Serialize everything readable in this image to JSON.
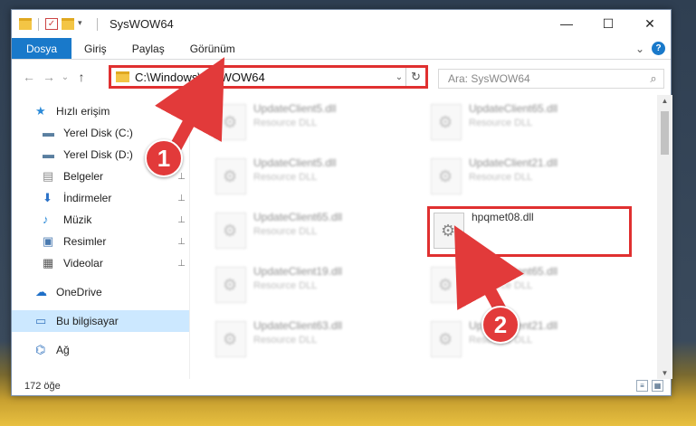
{
  "window": {
    "title": "SysWOW64",
    "controls": {
      "minimize": "—",
      "maximize": "☐",
      "close": "✕"
    }
  },
  "ribbon": {
    "tabs": [
      "Dosya",
      "Giriş",
      "Paylaş",
      "Görünüm"
    ],
    "expand_glyph": "⌄",
    "help_glyph": "?"
  },
  "address": {
    "path": "C:\\Windows\\SysWOW64",
    "back": "←",
    "forward": "→",
    "recent": "⌄",
    "up": "↑",
    "dropdown": "⌄",
    "refresh": "↻"
  },
  "search": {
    "placeholder": "Ara: SysWOW64",
    "icon": "⌕"
  },
  "sidebar": {
    "items": [
      {
        "label": "Hızlı erişim",
        "icon": "star-icon",
        "color": "#2b8ad8",
        "pinned": false
      },
      {
        "label": "Yerel Disk (C:)",
        "icon": "drive-icon",
        "color": "#5a7fa0",
        "pinned": true
      },
      {
        "label": "Yerel Disk (D:)",
        "icon": "drive-icon",
        "color": "#5a7fa0",
        "pinned": true
      },
      {
        "label": "Belgeler",
        "icon": "documents-icon",
        "color": "#8a8a8a",
        "pinned": true
      },
      {
        "label": "İndirmeler",
        "icon": "downloads-icon",
        "color": "#2b72c8",
        "pinned": true
      },
      {
        "label": "Müzik",
        "icon": "music-icon",
        "color": "#2b8ad8",
        "pinned": true
      },
      {
        "label": "Resimler",
        "icon": "pictures-icon",
        "color": "#4a7ab0",
        "pinned": true
      },
      {
        "label": "Videolar",
        "icon": "videos-icon",
        "color": "#555555",
        "pinned": true
      },
      {
        "label": "OneDrive",
        "icon": "cloud-icon",
        "color": "#1e6fc8",
        "pinned": false
      },
      {
        "label": "Bu bilgisayar",
        "icon": "computer-icon",
        "color": "#3a78c0",
        "pinned": false
      },
      {
        "label": "Ağ",
        "icon": "network-icon",
        "color": "#3a78c0",
        "pinned": false
      }
    ],
    "pin_glyph": "📌"
  },
  "files": {
    "left": [
      {
        "name": "UpdateClient5.dll",
        "type": "Resource DLL"
      },
      {
        "name": "UpdateClient5.dll",
        "type": "Resource DLL"
      },
      {
        "name": "UpdateClient65.dll",
        "type": "Resource DLL"
      },
      {
        "name": "UpdateClient19.dll",
        "type": "Resource DLL"
      },
      {
        "name": "UpdateClient63.dll",
        "type": "Resource DLL"
      }
    ],
    "right": [
      {
        "name": "UpdateClient65.dll",
        "type": "Resource DLL"
      },
      {
        "name": "UpdateClient21.dll",
        "type": "Resource DLL"
      },
      {
        "name": "UpdateClient65.dll",
        "type": "Resource DLL"
      },
      {
        "name": "UpdateClient21.dll",
        "type": "Resource DLL"
      }
    ],
    "highlighted": {
      "name": "hpqmet08.dll"
    }
  },
  "status": {
    "count": "172 öğe"
  },
  "callouts": {
    "one": "1",
    "two": "2"
  },
  "colors": {
    "accent": "#1979ca",
    "highlight": "#e03030",
    "selected": "#cce8ff"
  }
}
